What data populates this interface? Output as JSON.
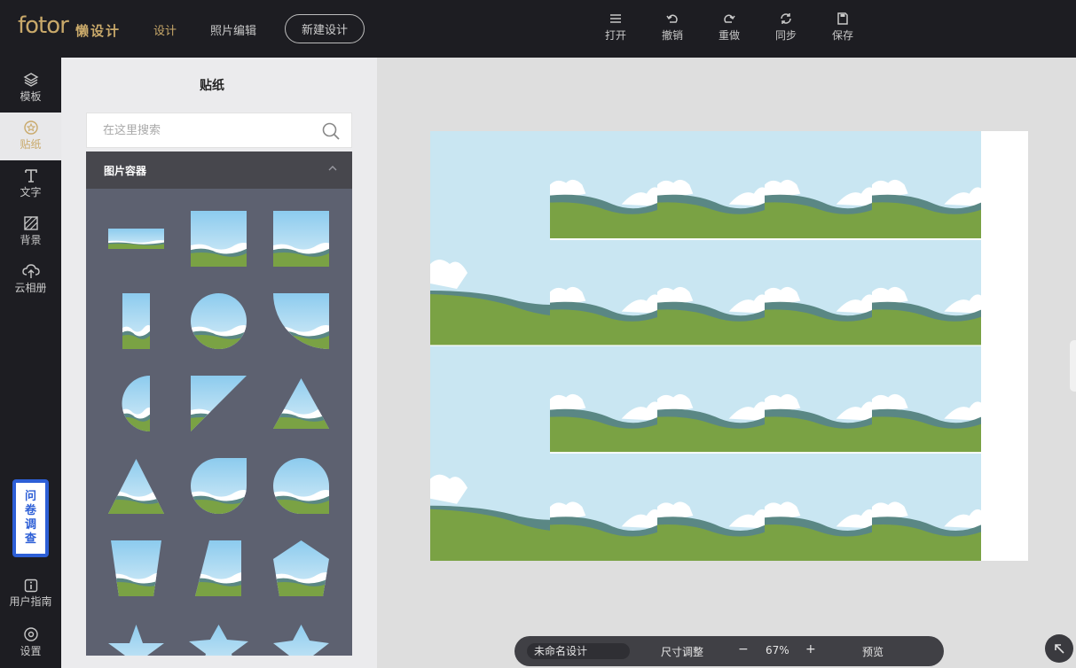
{
  "header": {
    "logo": "fotor",
    "logo_sub": "懒设计",
    "nav_design": "设计",
    "nav_photo": "照片编辑",
    "new_design": "新建设计",
    "tools": [
      {
        "label": "打开",
        "icon": "menu-icon"
      },
      {
        "label": "撤销",
        "icon": "undo-icon"
      },
      {
        "label": "重做",
        "icon": "redo-icon"
      },
      {
        "label": "同步",
        "icon": "sync-icon"
      },
      {
        "label": "保存",
        "icon": "save-icon"
      }
    ]
  },
  "sidebar": {
    "items": [
      {
        "label": "模板",
        "icon": "layers-icon"
      },
      {
        "label": "贴纸",
        "icon": "sticker-icon"
      },
      {
        "label": "文字",
        "icon": "text-icon"
      },
      {
        "label": "背景",
        "icon": "background-icon"
      },
      {
        "label": "云相册",
        "icon": "cloud-upload-icon"
      }
    ],
    "survey": [
      "问",
      "卷",
      "调",
      "查"
    ],
    "guide": "用户指南",
    "settings": "设置"
  },
  "panel": {
    "title": "贴纸",
    "search_placeholder": "在这里搜索",
    "category": "图片容器"
  },
  "bottom": {
    "doc_name": "未命名设计",
    "resize": "尺寸调整",
    "zoom_minus": "−",
    "zoom": "67%",
    "zoom_plus": "+",
    "preview": "预览"
  },
  "colors": {
    "accent": "#c9a96a",
    "dark": "#1d1d22",
    "sky": "#c9e6f2",
    "grass": "#7aa244",
    "hill": "#5a8784",
    "survey_blue": "#2d5fd6"
  }
}
